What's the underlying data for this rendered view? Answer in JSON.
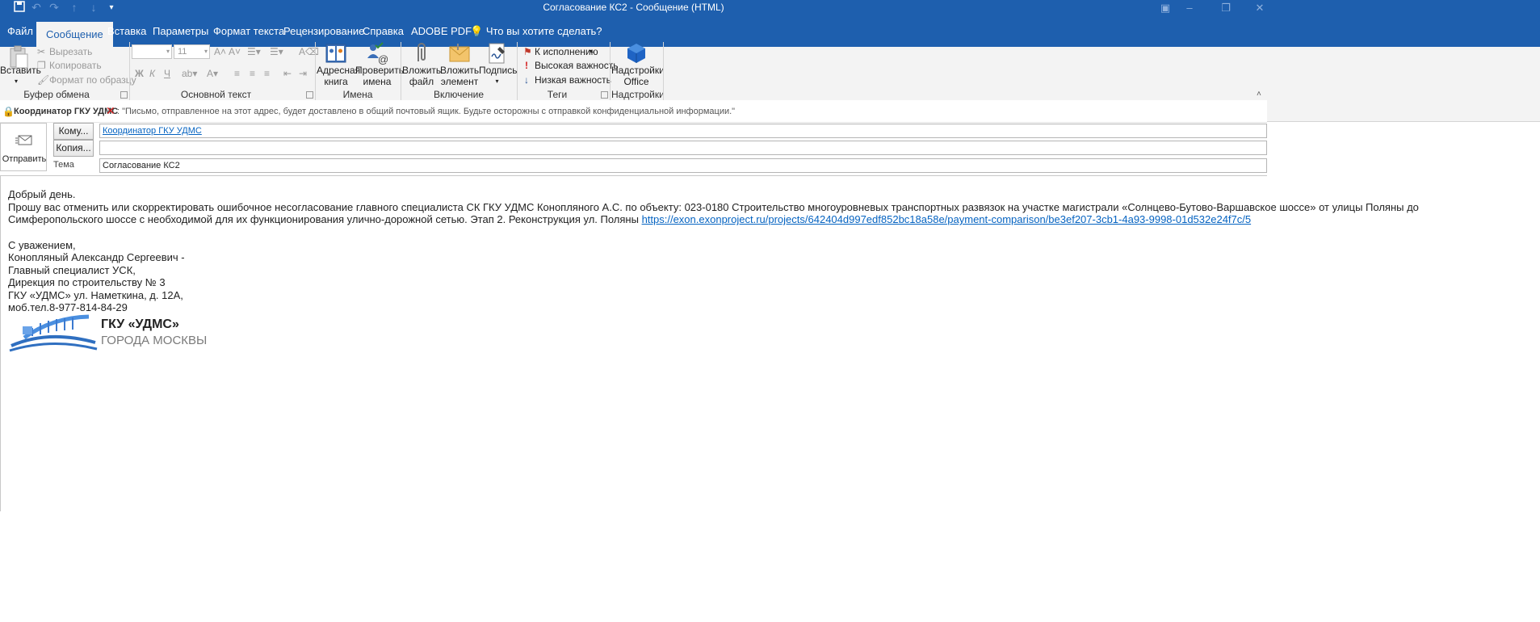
{
  "window": {
    "title": "Согласование КС2  -  Сообщение (HTML)"
  },
  "tabs": [
    "Файл",
    "Сообщение",
    "Вставка",
    "Параметры",
    "Формат текста",
    "Рецензирование",
    "Справка",
    "ADOBE PDF"
  ],
  "tell_me": "Что вы хотите сделать?",
  "ribbon": {
    "clipboard": {
      "paste": "Вставить",
      "cut": "Вырезать",
      "copy": "Копировать",
      "format_painter": "Формат по образцу",
      "label": "Буфер обмена"
    },
    "basic_text": {
      "font_size": "11",
      "bold": "Ж",
      "italic": "К",
      "underline": "Ч",
      "label": "Основной текст"
    },
    "names": {
      "address_book_l1": "Адресная",
      "address_book_l2": "книга",
      "check_names_l1": "Проверить",
      "check_names_l2": "имена",
      "label": "Имена"
    },
    "include": {
      "attach_file_l1": "Вложить",
      "attach_file_l2": "файл",
      "attach_item_l1": "Вложить",
      "attach_item_l2": "элемент",
      "signature": "Подпись",
      "label": "Включение"
    },
    "tags": {
      "follow_up": "К исполнению",
      "high": "Высокая важность",
      "low": "Низкая важность",
      "label": "Теги"
    },
    "addins": {
      "office_l1": "Надстройки",
      "office_l2": "Office",
      "label": "Надстройки"
    }
  },
  "infobar": {
    "name": "Координатор ГКУ УДМС",
    "message": ": \"Письмо, отправленное на этот адрес, будет доставлено в общий почтовый ящик. Будьте осторожны с отправкой конфиденциальной информации.\""
  },
  "compose": {
    "send": "Отправить",
    "to_btn": "Кому...",
    "cc_btn": "Копия...",
    "subject_label": "Тема",
    "to_value": "Координатор ГКУ УДМС",
    "cc_value": "",
    "subject_value": "Согласование КС2"
  },
  "body": {
    "greeting": "Добрый день.",
    "para_line1": "Прошу вас отменить или скорректировать ошибочное несогласование главного специалиста СК ГКУ УДМС Конопляного А.С. по объекту:  023-0180 Строительство многоуровневых транспортных развязок на участке магистрали «Солнцево-Бутово-Варшавское шоссе» от улицы Поляны до",
    "para_line2": "Симферопольского шоссе с необходимой для их функционирования улично-дорожной сетью. Этап 2. Реконструкция ул. Поляны ",
    "link": "https://exon.exonproject.ru/projects/642404d997edf852bc18a58e/payment-comparison/be3ef207-3cb1-4a93-9998-01d532e24f7c/5",
    "sig": [
      "С уважением,",
      "Конопляный Александр Сергеевич -",
      "Главный специалист УСК,",
      "Дирекция по строительству № 3",
      "ГКУ «УДМС» ул. Наметкина, д. 12А,",
      "моб.тел.8-977-814-84-29"
    ],
    "logo_title": "ГКУ «УДМС»",
    "logo_sub": "ГОРОДА МОСКВЫ"
  },
  "colors": {
    "accent": "#1e5fae",
    "link": "#0563c1",
    "ribbon_bg": "#f3f3f3"
  }
}
